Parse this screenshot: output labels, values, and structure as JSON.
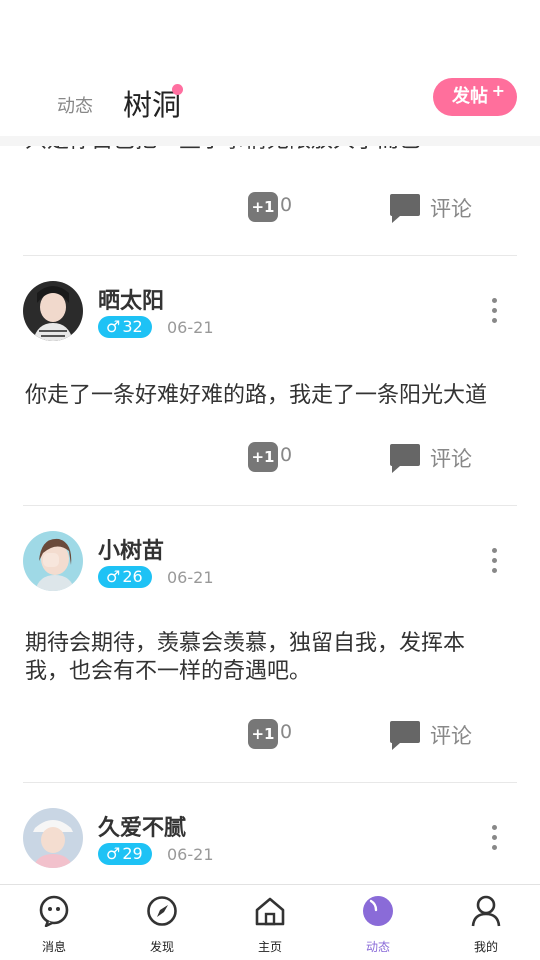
{
  "header": {
    "tabs": [
      {
        "label": "动态",
        "active": false
      },
      {
        "label": "树洞",
        "active": true
      }
    ],
    "post_button": {
      "label": "发帖",
      "plus": "+"
    }
  },
  "feed": {
    "partial_top": {
      "content": "只是你自己把一些小事情无限放大了而已",
      "likes": "0",
      "comment_label": "评论",
      "plus_one": "+1"
    },
    "posts": [
      {
        "username": "晒太阳",
        "gender_symbol": "♂",
        "age": "32",
        "date": "06-21",
        "content": "你走了一条好难好难的路，我走了一条阳光大道",
        "plus_one": "+1",
        "likes": "0",
        "comment_label": "评论"
      },
      {
        "username": "小树苗",
        "gender_symbol": "♂",
        "age": "26",
        "date": "06-21",
        "content": "期待会期待，羡慕会羡慕，独留自我，发挥本我，也会有不一样的奇遇吧。",
        "plus_one": "+1",
        "likes": "0",
        "comment_label": "评论"
      },
      {
        "username": "久爱不腻",
        "gender_symbol": "♂",
        "age": "29",
        "date": "06-21"
      }
    ]
  },
  "bottom_nav": {
    "items": [
      {
        "label": "消息",
        "icon": "message-icon",
        "active": false
      },
      {
        "label": "发现",
        "icon": "compass-icon",
        "active": false
      },
      {
        "label": "主页",
        "icon": "home-icon",
        "active": false
      },
      {
        "label": "动态",
        "icon": "moments-icon",
        "active": true
      },
      {
        "label": "我的",
        "icon": "profile-icon",
        "active": false
      }
    ]
  },
  "colors": {
    "accent_pink": "#ff6f9c",
    "badge_blue": "#1ec2f5",
    "nav_active": "#8a6bd8"
  }
}
